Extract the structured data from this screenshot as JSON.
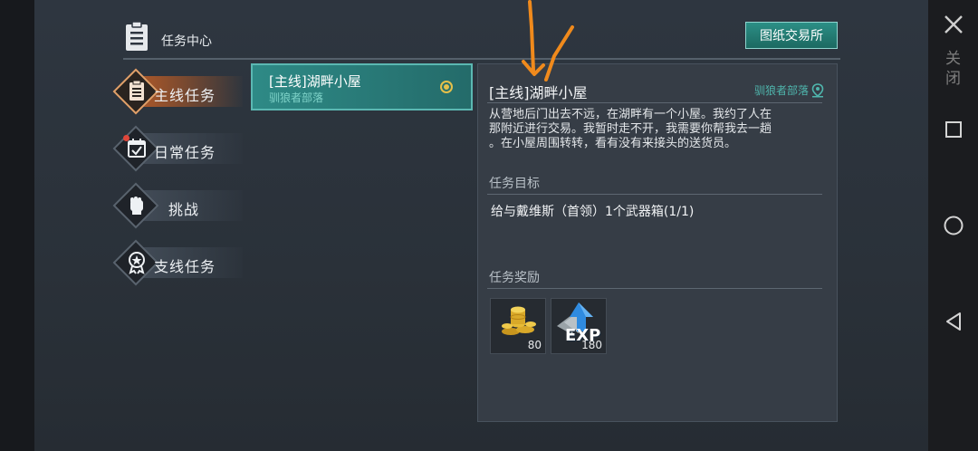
{
  "header": {
    "title": "任务中心",
    "trade_button": "图纸交易所"
  },
  "tabs": [
    {
      "label": "主线任务",
      "active": true,
      "icon": "clipboard-icon"
    },
    {
      "label": "日常任务",
      "active": false,
      "icon": "calendar-check-icon",
      "notification": true
    },
    {
      "label": "挑战",
      "active": false,
      "icon": "fist-icon"
    },
    {
      "label": "支线任务",
      "active": false,
      "icon": "medal-icon"
    }
  ],
  "quest_list": [
    {
      "title": "[主线]湖畔小屋",
      "subtitle": "驯狼者部落",
      "selected": true
    }
  ],
  "detail": {
    "title": "[主线]湖畔小屋",
    "location": "驯狼者部落",
    "description_lines": [
      "从营地后门出去不远，在湖畔有一个小屋。我约了人在",
      "那附近进行交易。我暂时走不开，我需要你帮我去一趟",
      "。在小屋周围转转，看有没有来接头的送货员。"
    ],
    "goal_heading": "任务目标",
    "goal": "给与戴维斯（首领）1个武器箱(1/1)",
    "reward_heading": "任务奖励",
    "rewards": [
      {
        "icon": "gold-coins-icon",
        "count": "80"
      },
      {
        "icon": "exp-icon",
        "label": "EXP",
        "count": "180"
      }
    ]
  },
  "system_nav": {
    "close_label_1": "关",
    "close_label_2": "闭"
  },
  "colors": {
    "accent_teal": "#2e8a86",
    "active_tab": "#b35a28",
    "annotation": "#f08a1c"
  }
}
